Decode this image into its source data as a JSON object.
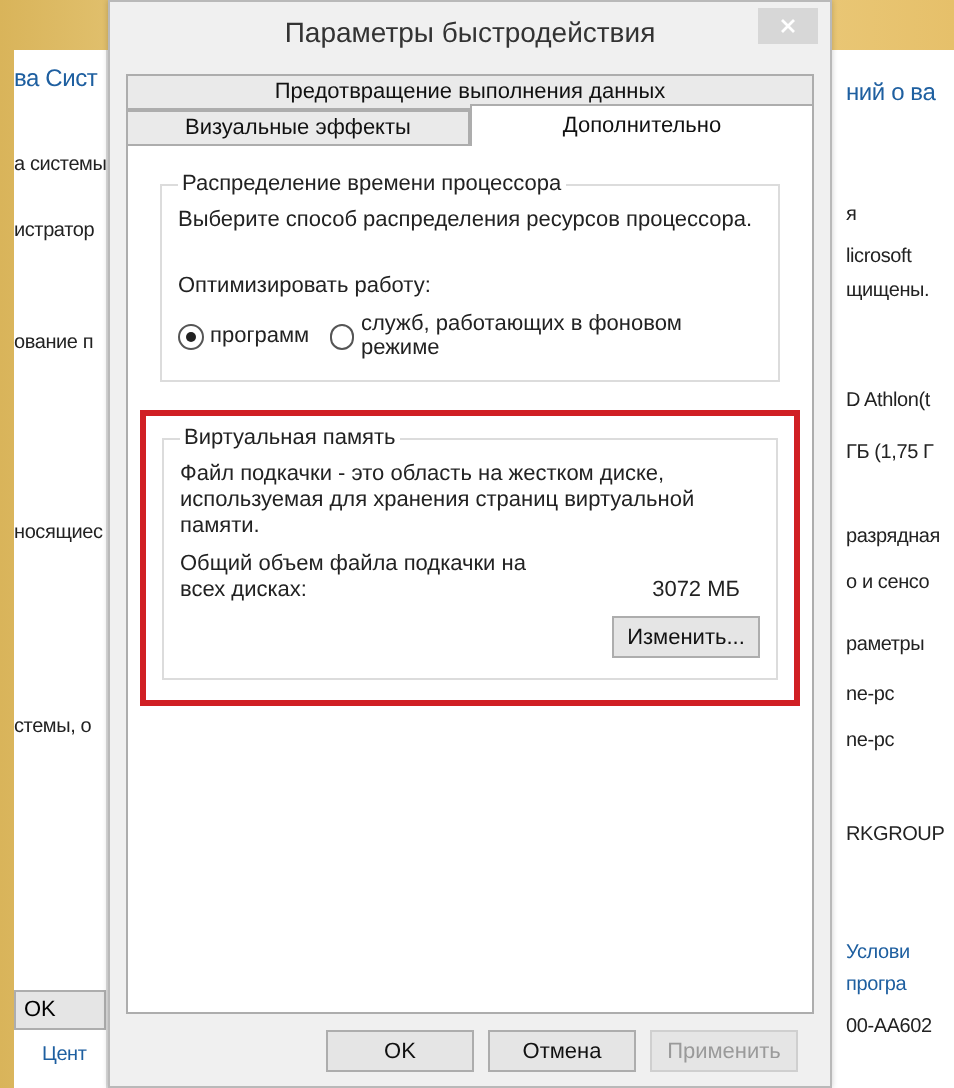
{
  "background_window": {
    "left_texts": [
      {
        "text": "ва Сист",
        "kind": "heading"
      },
      {
        "text": "а системы",
        "kind": "text"
      },
      {
        "text": "истратор",
        "kind": "text"
      },
      {
        "text": "ование п",
        "kind": "text"
      },
      {
        "text": "носящиес",
        "kind": "text"
      },
      {
        "text": "стемы, о",
        "kind": "text"
      }
    ],
    "ok_button": "OK",
    "left_link": "Цент",
    "right_texts": [
      {
        "text": "ний о ва",
        "kind": "heading"
      },
      {
        "text": "я",
        "kind": "text"
      },
      {
        "text": "licrosoft",
        "kind": "text"
      },
      {
        "text": "щищены.",
        "kind": "text"
      },
      {
        "text": "D Athlon(t",
        "kind": "text"
      },
      {
        "text": "ГБ (1,75 Г",
        "kind": "text"
      },
      {
        "text": "разрядная",
        "kind": "text"
      },
      {
        "text": "о и сенсо",
        "kind": "text"
      },
      {
        "text": "раметры",
        "kind": "text"
      },
      {
        "text": "ne-pc",
        "kind": "text"
      },
      {
        "text": "ne-pc",
        "kind": "text"
      },
      {
        "text": "RKGROUP",
        "kind": "text"
      },
      {
        "text": "Услови",
        "kind": "link"
      },
      {
        "text": "програ",
        "kind": "link"
      },
      {
        "text": "00-AA602",
        "kind": "text"
      }
    ]
  },
  "dialog": {
    "title": "Параметры быстродействия",
    "tab_rows": [
      [
        {
          "label": "Предотвращение выполнения данных",
          "selected": false
        }
      ],
      [
        {
          "label": "Визуальные эффекты",
          "selected": false
        },
        {
          "label": "Дополнительно",
          "selected": true
        }
      ]
    ],
    "processor_group": {
      "title": "Распределение времени процессора",
      "description": "Выберите способ распределения ресурсов процессора.",
      "optimize_label": "Оптимизировать работу:",
      "options": [
        {
          "label": "программ",
          "selected": true
        },
        {
          "label": "служб, работающих в фоновом режиме",
          "selected": false
        }
      ]
    },
    "virtual_memory": {
      "title": "Виртуальная память",
      "description": "Файл подкачки - это область на жестком диске, используемая для хранения страниц виртуальной памяти.",
      "total_label": "Общий объем файла подкачки на всех дисках:",
      "total_value": "3072 МБ",
      "change_button": "Изменить...",
      "highlighted": true
    },
    "buttons": [
      {
        "label": "OK",
        "disabled": false
      },
      {
        "label": "Отмена",
        "disabled": false
      },
      {
        "label": "Применить",
        "disabled": true
      }
    ]
  }
}
